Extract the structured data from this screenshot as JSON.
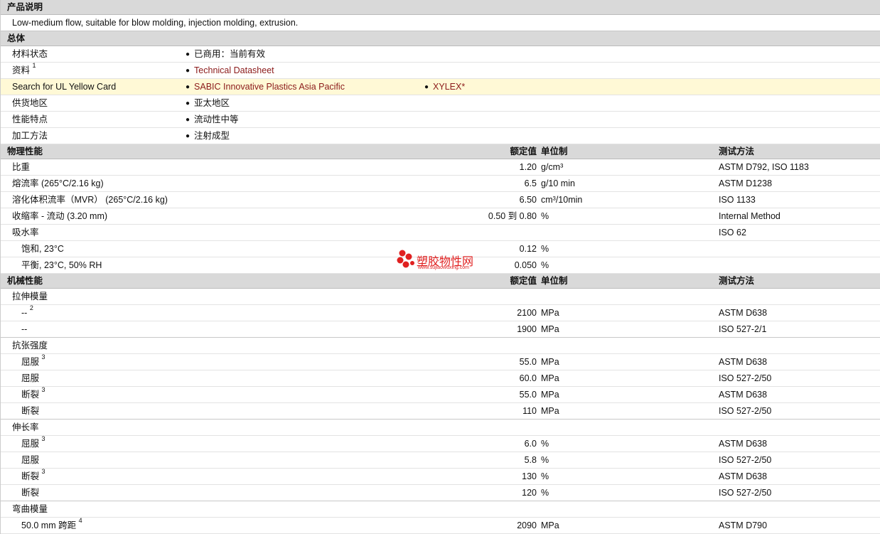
{
  "product_description": {
    "title": "产品说明",
    "text": "Low-medium flow, suitable for blow molding, injection molding, extrusion."
  },
  "general": {
    "title": "总体",
    "rows": [
      {
        "label": "材料状态",
        "values": [
          "已商用：当前有效"
        ]
      },
      {
        "label": "资料",
        "sup": "1",
        "values": [
          "Technical Datasheet"
        ],
        "links": true
      },
      {
        "label": "Search for UL Yellow Card",
        "values": [
          "SABIC Innovative Plastics Asia Pacific",
          "XYLEX*"
        ],
        "links": true,
        "highlight": true
      },
      {
        "label": "供货地区",
        "values": [
          "亚太地区"
        ]
      },
      {
        "label": "性能特点",
        "values": [
          "流动性中等"
        ]
      },
      {
        "label": "加工方法",
        "values": [
          "注射成型"
        ]
      }
    ]
  },
  "physical": {
    "title": "物理性能",
    "col_value": "额定值",
    "col_unit": "单位制",
    "col_method": "测试方法",
    "rows": [
      {
        "label": "比重",
        "value": "1.20",
        "unit": "g/cm³",
        "method": "ASTM D792, ISO 1183"
      },
      {
        "label": "熔流率  (265°C/2.16 kg)",
        "value": "6.5",
        "unit": "g/10 min",
        "method": "ASTM D1238"
      },
      {
        "label": "溶化体积流率（MVR） (265°C/2.16 kg)",
        "value": "6.50",
        "unit": "cm³/10min",
        "method": "ISO 1133"
      },
      {
        "label": "收缩率  - 流动  (3.20 mm)",
        "value": "0.50 到  0.80",
        "unit": "%",
        "method": "Internal Method"
      },
      {
        "label": "吸水率",
        "value": "",
        "unit": "",
        "method": "ISO 62"
      },
      {
        "label": "饱和, 23°C",
        "sub": true,
        "value": "0.12",
        "unit": "%",
        "method": ""
      },
      {
        "label": "平衡, 23°C, 50% RH",
        "sub": true,
        "value": "0.050",
        "unit": "%",
        "method": ""
      }
    ]
  },
  "mechanical": {
    "title": "机械性能",
    "col_value": "额定值",
    "col_unit": "单位制",
    "col_method": "测试方法",
    "rows": [
      {
        "label": "拉伸模量",
        "value": "",
        "unit": "",
        "method": ""
      },
      {
        "label": "--",
        "sup": "2",
        "sub": true,
        "value": "2100",
        "unit": "MPa",
        "method": "ASTM D638"
      },
      {
        "label": "--",
        "sub": true,
        "value": "1900",
        "unit": "MPa",
        "method": "ISO 527-2/1",
        "thick": true
      },
      {
        "label": "抗张强度",
        "value": "",
        "unit": "",
        "method": ""
      },
      {
        "label": "屈服",
        "sup": "3",
        "sub": true,
        "value": "55.0",
        "unit": "MPa",
        "method": "ASTM D638"
      },
      {
        "label": "屈服",
        "sub": true,
        "value": "60.0",
        "unit": "MPa",
        "method": "ISO 527-2/50"
      },
      {
        "label": "断裂",
        "sup": "3",
        "sub": true,
        "value": "55.0",
        "unit": "MPa",
        "method": "ASTM D638"
      },
      {
        "label": "断裂",
        "sub": true,
        "value": "110",
        "unit": "MPa",
        "method": "ISO 527-2/50",
        "thick": true
      },
      {
        "label": "伸长率",
        "value": "",
        "unit": "",
        "method": ""
      },
      {
        "label": "屈服",
        "sup": "3",
        "sub": true,
        "value": "6.0",
        "unit": "%",
        "method": "ASTM D638"
      },
      {
        "label": "屈服",
        "sub": true,
        "value": "5.8",
        "unit": "%",
        "method": "ISO 527-2/50"
      },
      {
        "label": "断裂",
        "sup": "3",
        "sub": true,
        "value": "130",
        "unit": "%",
        "method": "ASTM D638"
      },
      {
        "label": "断裂",
        "sub": true,
        "value": "120",
        "unit": "%",
        "method": "ISO 527-2/50",
        "thick": true
      },
      {
        "label": "弯曲模量",
        "value": "",
        "unit": "",
        "method": ""
      },
      {
        "label": "50.0 mm 跨距",
        "sup": "4",
        "sub": true,
        "value": "2090",
        "unit": "MPa",
        "method": "ASTM D790"
      }
    ]
  },
  "watermark": {
    "text": "塑胶物性网",
    "sub": "www.sujiaowuxing.com"
  },
  "colors": {
    "section_bg": "#d9d9d9",
    "link": "#8b1a1a",
    "highlight": "#fff9d6",
    "watermark": "#e02020"
  }
}
